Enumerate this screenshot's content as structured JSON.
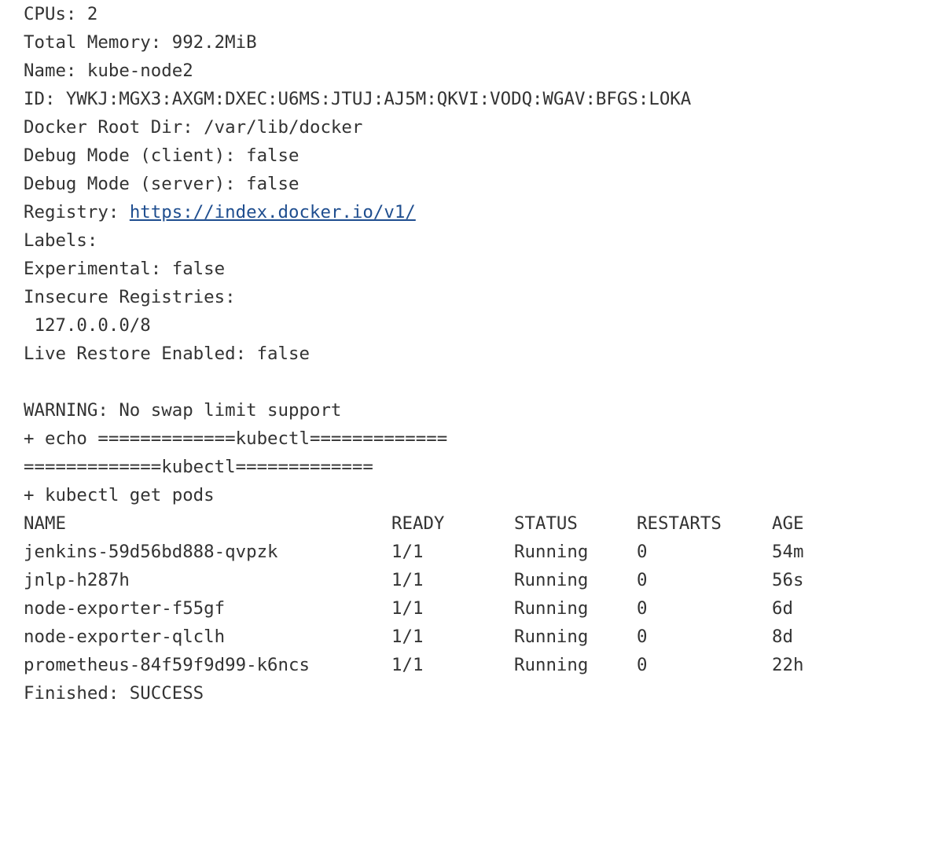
{
  "info": {
    "cpus": "CPUs: 2",
    "memory": "Total Memory: 992.2MiB",
    "name": "Name: kube-node2",
    "id": "ID: YWKJ:MGX3:AXGM:DXEC:U6MS:JTUJ:AJ5M:QKVI:VODQ:WGAV:BFGS:LOKA",
    "root_dir": "Docker Root Dir: /var/lib/docker",
    "debug_client": "Debug Mode (client): false",
    "debug_server": "Debug Mode (server): false",
    "registry_label": "Registry: ",
    "registry_url": "https://index.docker.io/v1/",
    "labels": "Labels:",
    "experimental": "Experimental: false",
    "insecure": "Insecure Registries:",
    "insecure_value": " 127.0.0.0/8",
    "live_restore": "Live Restore Enabled: false"
  },
  "output": {
    "warning": "WARNING: No swap limit support",
    "echo_cmd": "+ echo =============kubectl=============",
    "echo_out": "=============kubectl=============",
    "get_pods_cmd": "+ kubectl get pods",
    "finished": "Finished: SUCCESS"
  },
  "pods_table": {
    "headers": {
      "name": "NAME",
      "ready": "READY",
      "status": "STATUS",
      "restarts": "RESTARTS",
      "age": "AGE"
    },
    "rows": [
      {
        "name": "jenkins-59d56bd888-qvpzk",
        "ready": "1/1",
        "status": "Running",
        "restarts": "0",
        "age": "54m"
      },
      {
        "name": "jnlp-h287h",
        "ready": "1/1",
        "status": "Running",
        "restarts": "0",
        "age": "56s"
      },
      {
        "name": "node-exporter-f55gf",
        "ready": "1/1",
        "status": "Running",
        "restarts": "0",
        "age": "6d"
      },
      {
        "name": "node-exporter-qlclh",
        "ready": "1/1",
        "status": "Running",
        "restarts": "0",
        "age": "8d"
      },
      {
        "name": "prometheus-84f59f9d99-k6ncs",
        "ready": "1/1",
        "status": "Running",
        "restarts": "0",
        "age": "22h"
      }
    ]
  },
  "colors": {
    "text": "#333333",
    "link": "#1f4e8f",
    "background": "#ffffff"
  }
}
